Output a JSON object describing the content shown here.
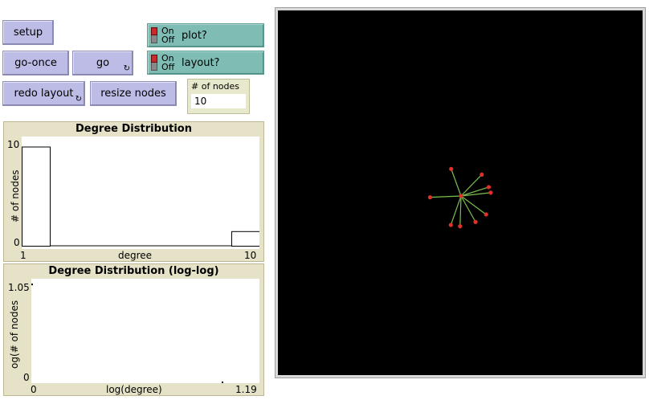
{
  "buttons": {
    "setup": "setup",
    "go_once": "go-once",
    "go": "go",
    "redo_layout": "redo layout",
    "resize_nodes": "resize nodes",
    "forever_icon": "↻"
  },
  "switches": {
    "plot": {
      "on": "On",
      "off": "Off",
      "label": "plot?"
    },
    "layout": {
      "on": "On",
      "off": "Off",
      "label": "layout?"
    }
  },
  "num_nodes": {
    "label": "# of nodes",
    "value": "10"
  },
  "colors": {
    "button": "#bcbce6",
    "switch": "#7fbdb4",
    "plot_frame": "#e5e2c7",
    "node": "#e0302a",
    "link": "#7ac04e",
    "world": "#000000"
  },
  "plot1": {
    "title": "Degree Distribution",
    "xlabel": "degree",
    "ylabel": "# of nodes",
    "xmin_label": "1",
    "xmax_label": "10",
    "ymin_label": "0",
    "ymax_label": "10"
  },
  "plot2": {
    "title": "Degree Distribution (log-log)",
    "xlabel": "log(degree)",
    "ylabel": "og(# of nodes",
    "xmin_label": "0",
    "xmax_label": "1.19",
    "ymin_label": "0",
    "ymax_label": "1.05"
  },
  "chart_data": [
    {
      "type": "bar",
      "title": "Degree Distribution",
      "xlabel": "degree",
      "ylabel": "# of nodes",
      "xlim": [
        1,
        10
      ],
      "ylim": [
        0,
        10
      ],
      "bars": [
        {
          "x": 1,
          "value": 9.5
        },
        {
          "x": 10,
          "value": 1.4
        }
      ]
    },
    {
      "type": "scatter",
      "title": "Degree Distribution (log-log)",
      "xlabel": "log(degree)",
      "ylabel": "og(# of nodes",
      "xlim": [
        0,
        1.19
      ],
      "ylim": [
        0,
        1.05
      ],
      "points": [
        {
          "x": 0,
          "y": 1.0
        },
        {
          "x": 1.0,
          "y": 0.0
        }
      ]
    }
  ],
  "network": {
    "hub": 1,
    "nodes": [
      [
        0.0,
        0.0
      ],
      [
        0.0,
        0.0
      ],
      [
        -0.3,
        -0.82
      ],
      [
        0.63,
        -0.65
      ],
      [
        0.84,
        -0.27
      ],
      [
        0.9,
        -0.1
      ],
      [
        -0.94,
        0.04
      ],
      [
        0.76,
        0.56
      ],
      [
        0.44,
        0.79
      ],
      [
        -0.31,
        0.88
      ],
      [
        -0.03,
        0.92
      ]
    ]
  }
}
